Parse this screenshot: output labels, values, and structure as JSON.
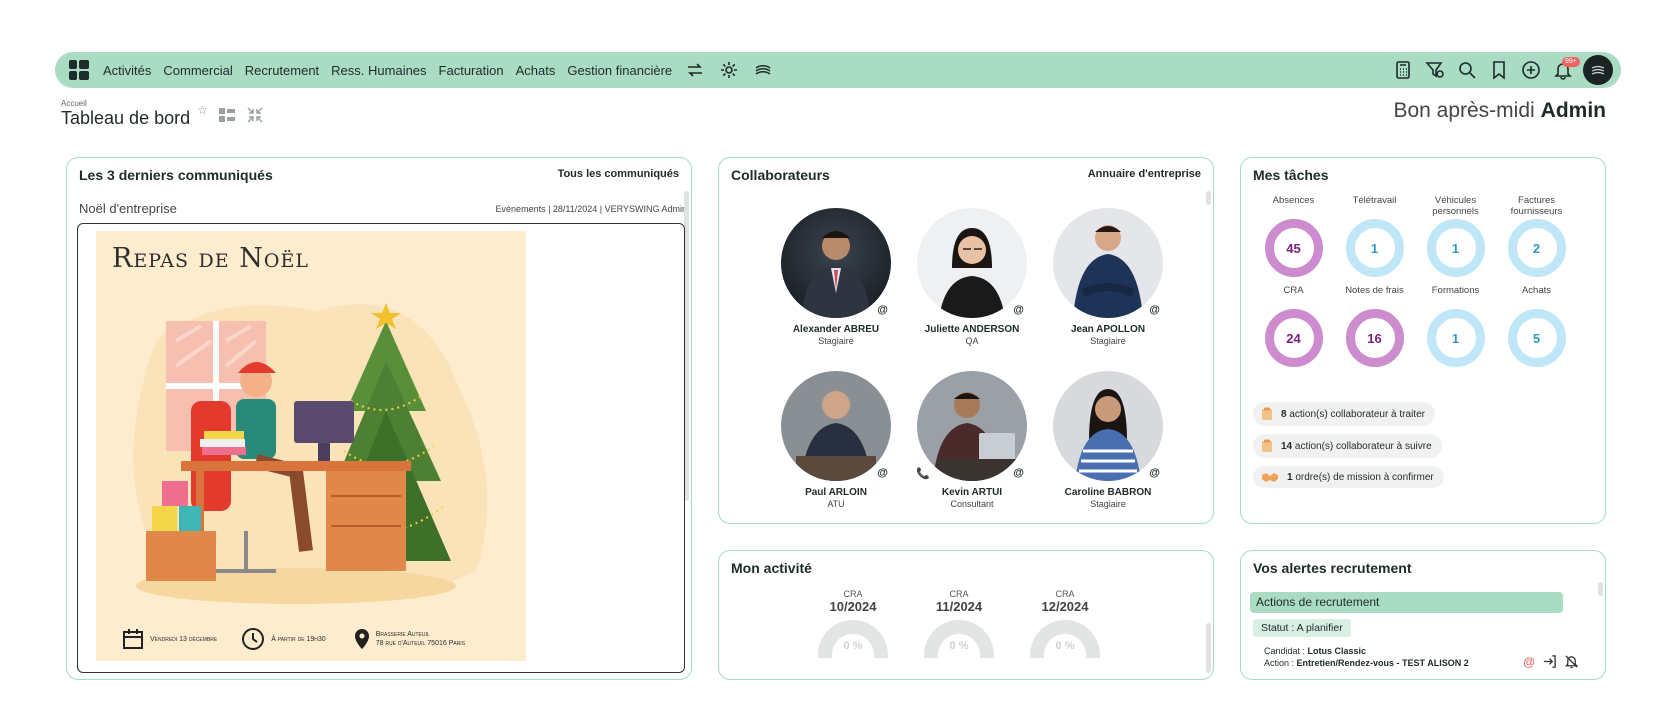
{
  "nav": {
    "items": [
      "Activités",
      "Commercial",
      "Recrutement",
      "Ress. Humaines",
      "Facturation",
      "Achats",
      "Gestion financière"
    ],
    "notif_count": "99+"
  },
  "header": {
    "breadcrumb": "Accueil",
    "title": "Tableau de bord",
    "greeting": "Bon après-midi",
    "user": "Admin"
  },
  "news": {
    "title": "Les 3 derniers communiqués",
    "link": "Tous les communiqués",
    "item_title": "Noël d'entreprise",
    "item_meta": "Evénements | 28/11/2024 | VERYSWING Admin",
    "poster": {
      "heading": "Repas de Noël",
      "date": "Vendredi 13 décembre",
      "time": "À partir de 19h30",
      "place_line1": "Brasserie Auteuil",
      "place_line2": "78 rue d'Auteuil 75016 Paris"
    }
  },
  "collab": {
    "title": "Collaborateurs",
    "link": "Annuaire d'entreprise",
    "people": [
      {
        "name": "Alexander ABREU",
        "role": "Stagiaire"
      },
      {
        "name": "Juliette ANDERSON",
        "role": "QA"
      },
      {
        "name": "Jean APOLLON",
        "role": "Stagiaire"
      },
      {
        "name": "Paul ARLOIN",
        "role": "ATU"
      },
      {
        "name": "Kevin ARTUI",
        "role": "Consultant"
      },
      {
        "name": "Caroline BABRON",
        "role": "Stagiaire"
      }
    ]
  },
  "tasks": {
    "title": "Mes tâches",
    "items": [
      {
        "label": "Absences",
        "value": "45",
        "style": "violet"
      },
      {
        "label": "Télétravail",
        "value": "1",
        "style": "blue"
      },
      {
        "label": "Véhicules personnels",
        "value": "1",
        "style": "blue"
      },
      {
        "label": "Factures fournisseurs",
        "value": "2",
        "style": "blue"
      },
      {
        "label": "CRA",
        "value": "24",
        "style": "violet"
      },
      {
        "label": "Notes de frais",
        "value": "16",
        "style": "violet"
      },
      {
        "label": "Formations",
        "value": "1",
        "style": "blue"
      },
      {
        "label": "Achats",
        "value": "5",
        "style": "blue"
      }
    ],
    "actions": [
      {
        "count": "8",
        "text": "action(s) collaborateur à traiter"
      },
      {
        "count": "14",
        "text": "action(s) collaborateur à suivre"
      },
      {
        "count": "1",
        "text": "ordre(s) de mission à confirmer"
      }
    ]
  },
  "activity": {
    "title": "Mon activité",
    "items": [
      {
        "label": "CRA",
        "date": "10/2024",
        "value": "0 %"
      },
      {
        "label": "CRA",
        "date": "11/2024",
        "value": "0 %"
      },
      {
        "label": "CRA",
        "date": "12/2024",
        "value": "0 %"
      }
    ]
  },
  "alerts": {
    "title": "Vos alertes recrutement",
    "section": "Actions de recrutement",
    "status": "Statut : A planifier",
    "candidate_label": "Candidat :",
    "candidate": "Lotus Classic",
    "action_label": "Action :",
    "action": "Entretien/Rendez-vous - TEST ALISON 2"
  },
  "colors": {
    "accent": "#a9dcc3",
    "violet": "#cc8ccd",
    "blue": "#bfe7f8",
    "alert": "#f06161"
  }
}
